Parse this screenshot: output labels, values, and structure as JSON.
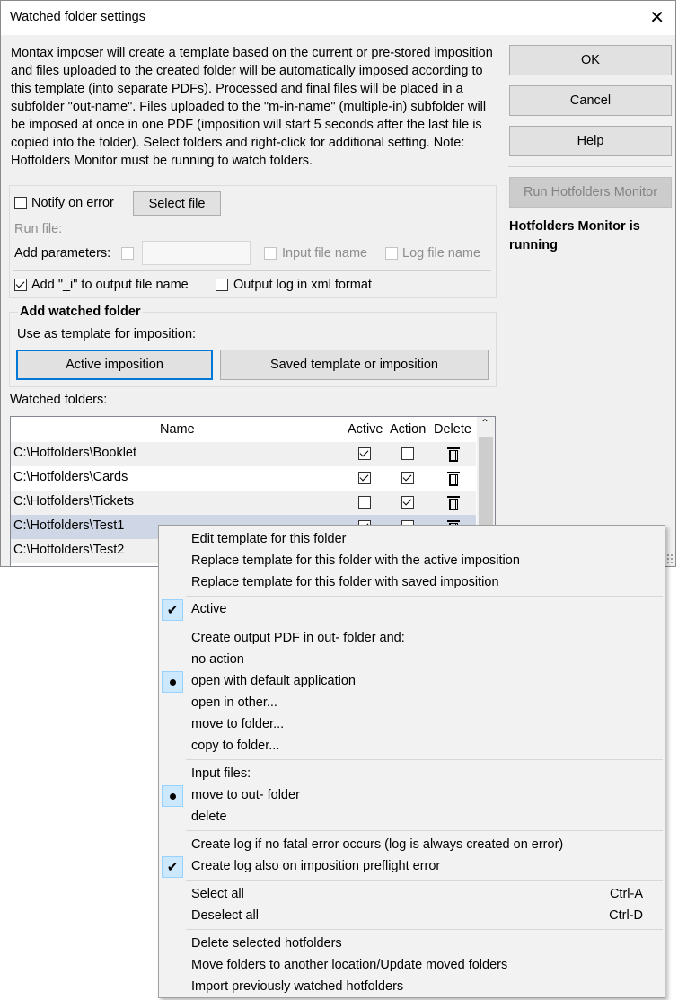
{
  "window": {
    "title": "Watched folder settings",
    "close_symbol": "✕"
  },
  "description": "Montax imposer will create a template based on the current or pre-stored imposition and files uploaded to the created folder will be automatically imposed according to this template (into separate PDFs). Processed and final files will be placed in a subfolder \"out-name\". Files uploaded to the \"m-in-name\" (multiple-in) subfolder will be imposed at once in one PDF (imposition will start 5 seconds after the last file is copied into the folder). Select folders and right-click for additional setting. Note: Hotfolders Monitor must be running to watch folders.",
  "buttons": {
    "ok": "OK",
    "cancel": "Cancel",
    "help": "Help",
    "run_monitor": "Run Hotfolders Monitor"
  },
  "monitor_status": "Hotfolders Monitor is running",
  "options": {
    "notify_on_error": "Notify on error",
    "select_file": "Select file",
    "run_file": "Run file:",
    "add_parameters": "Add parameters:",
    "input_file_name": "Input file name",
    "log_file_name": "Log file name",
    "add_i": "Add \"_i\" to output file name",
    "output_log_xml": "Output log in xml format"
  },
  "add_watched": {
    "heading": "Add watched folder",
    "use_as_template": "Use as template for imposition:",
    "active_imposition": "Active imposition",
    "saved_template": "Saved template or imposition"
  },
  "watched_folders_label": "Watched folders:",
  "table": {
    "headers": {
      "name": "Name",
      "active": "Active",
      "action": "Action",
      "delete": "Delete"
    },
    "rows": [
      {
        "name": "C:\\Hotfolders\\Booklet",
        "active": true,
        "action": false
      },
      {
        "name": "C:\\Hotfolders\\Cards",
        "active": true,
        "action": true
      },
      {
        "name": "C:\\Hotfolders\\Tickets",
        "active": false,
        "action": true
      },
      {
        "name": "C:\\Hotfolders\\Test1",
        "active": true,
        "action": false
      },
      {
        "name": "C:\\Hotfolders\\Test2",
        "active": false,
        "action": false
      }
    ]
  },
  "context_menu": {
    "edit_template": "Edit template for this folder",
    "replace_active": "Replace template for this folder with the active imposition",
    "replace_saved": "Replace template for this folder with saved imposition",
    "active": "Active",
    "create_output": "Create output PDF in out- folder and:",
    "no_action": "no action",
    "open_default": "open with default application",
    "open_other": "open in other...",
    "move_to_folder": "move to folder...",
    "copy_to_folder": "copy to folder...",
    "input_files": "Input files:",
    "move_to_out": "move to out- folder",
    "delete": "delete",
    "create_log_no_fatal": "Create log if no fatal error occurs (log is always created on error)",
    "create_log_preflight": "Create log also on imposition preflight error",
    "select_all": "Select all",
    "select_all_shortcut": "Ctrl-A",
    "deselect_all": "Deselect all",
    "deselect_all_shortcut": "Ctrl-D",
    "delete_selected": "Delete selected hotfolders",
    "move_folders": "Move folders to another location/Update moved folders",
    "import_previous": "Import previously watched hotfolders"
  }
}
